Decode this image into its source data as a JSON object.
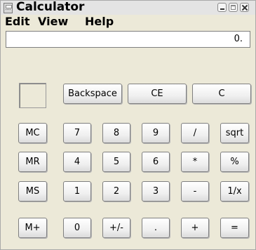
{
  "window": {
    "title": "Calculator"
  },
  "menu": {
    "edit": "Edit",
    "view": "View",
    "help": "Help"
  },
  "display": {
    "value": "0."
  },
  "buttons": {
    "backspace": "Backspace",
    "ce": "CE",
    "c": "C",
    "mc": "MC",
    "mr": "MR",
    "ms": "MS",
    "mplus": "M+",
    "seven": "7",
    "eight": "8",
    "nine": "9",
    "divide": "/",
    "sqrt": "sqrt",
    "four": "4",
    "five": "5",
    "six": "6",
    "multiply": "*",
    "percent": "%",
    "one": "1",
    "two": "2",
    "three": "3",
    "minus": "-",
    "reciprocal": "1/x",
    "zero": "0",
    "plusminus": "+/-",
    "decimal": ".",
    "plus": "+",
    "equals": "="
  },
  "icons": {
    "app": "calculator-icon",
    "minimize": "minimize-icon",
    "maximize": "maximize-icon",
    "close": "close-icon"
  }
}
